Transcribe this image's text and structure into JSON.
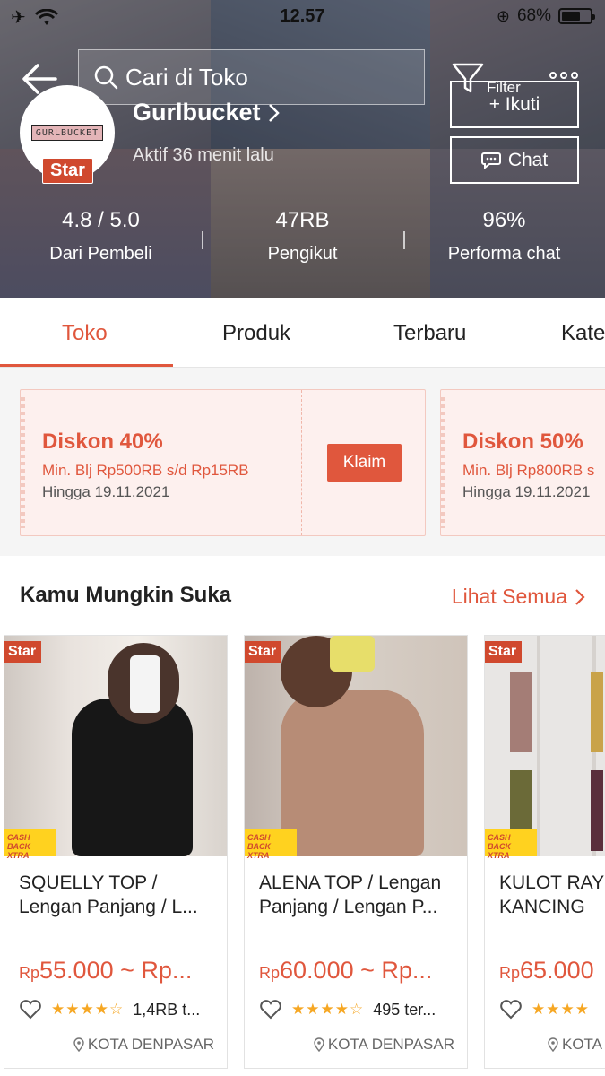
{
  "status_bar": {
    "time": "12.57",
    "battery_text": "68%",
    "battery_level": 0.68
  },
  "header": {
    "search_placeholder": "Cari di Toko",
    "filter_label": "Filter",
    "shop_name": "Gurlbucket",
    "logo_text": "GURLBUCKET",
    "star_badge": "Star",
    "active_status": "Aktif 36 menit lalu",
    "follow_button": "+ Ikuti",
    "chat_button": "Chat"
  },
  "stats": [
    {
      "value": "4.8 / 5.0",
      "label": "Dari Pembeli"
    },
    {
      "value": "47RB",
      "label": "Pengikut"
    },
    {
      "value": "96%",
      "label": "Performa chat"
    }
  ],
  "tabs": [
    "Toko",
    "Produk",
    "Terbaru",
    "Kate"
  ],
  "vouchers": [
    {
      "title": "Diskon 40%",
      "min": "Min. Blj Rp500RB s/d Rp15RB",
      "until": "Hingga 19.11.2021",
      "button": "Klaim"
    },
    {
      "title": "Diskon 50%",
      "min": "Min. Blj Rp800RB s",
      "until": "Hingga 19.11.2021"
    }
  ],
  "recommendations": {
    "title": "Kamu Mungkin Suka",
    "see_all": "Lihat Semua",
    "products": [
      {
        "star": "Star",
        "cashback": "CASH BACK XTRA",
        "name": "SQUELLY TOP / Lengan Panjang / L...",
        "currency": "Rp",
        "price": "55.000 ~ Rp...",
        "sold": "1,4RB t...",
        "location": "KOTA DENPASAR",
        "rating": 4.5
      },
      {
        "star": "Star",
        "cashback": "CASH BACK XTRA",
        "name": "ALENA TOP / Lengan Panjang / Lengan P...",
        "currency": "Rp",
        "price": "60.000 ~ Rp...",
        "sold": "495 ter...",
        "location": "KOTA DENPASAR",
        "rating": 4.5
      },
      {
        "star": "Star",
        "cashback": "CASH BACK XTRA",
        "name": "KULOT RAY KANCING",
        "currency": "Rp",
        "price": "65.000",
        "sold": "",
        "location": "KOTA",
        "rating": 4.5
      }
    ]
  },
  "colors": {
    "accent": "#e0573d",
    "star_badge": "#d0492e",
    "voucher_bg": "#fdf0ee",
    "rating_star": "#f6a723"
  }
}
